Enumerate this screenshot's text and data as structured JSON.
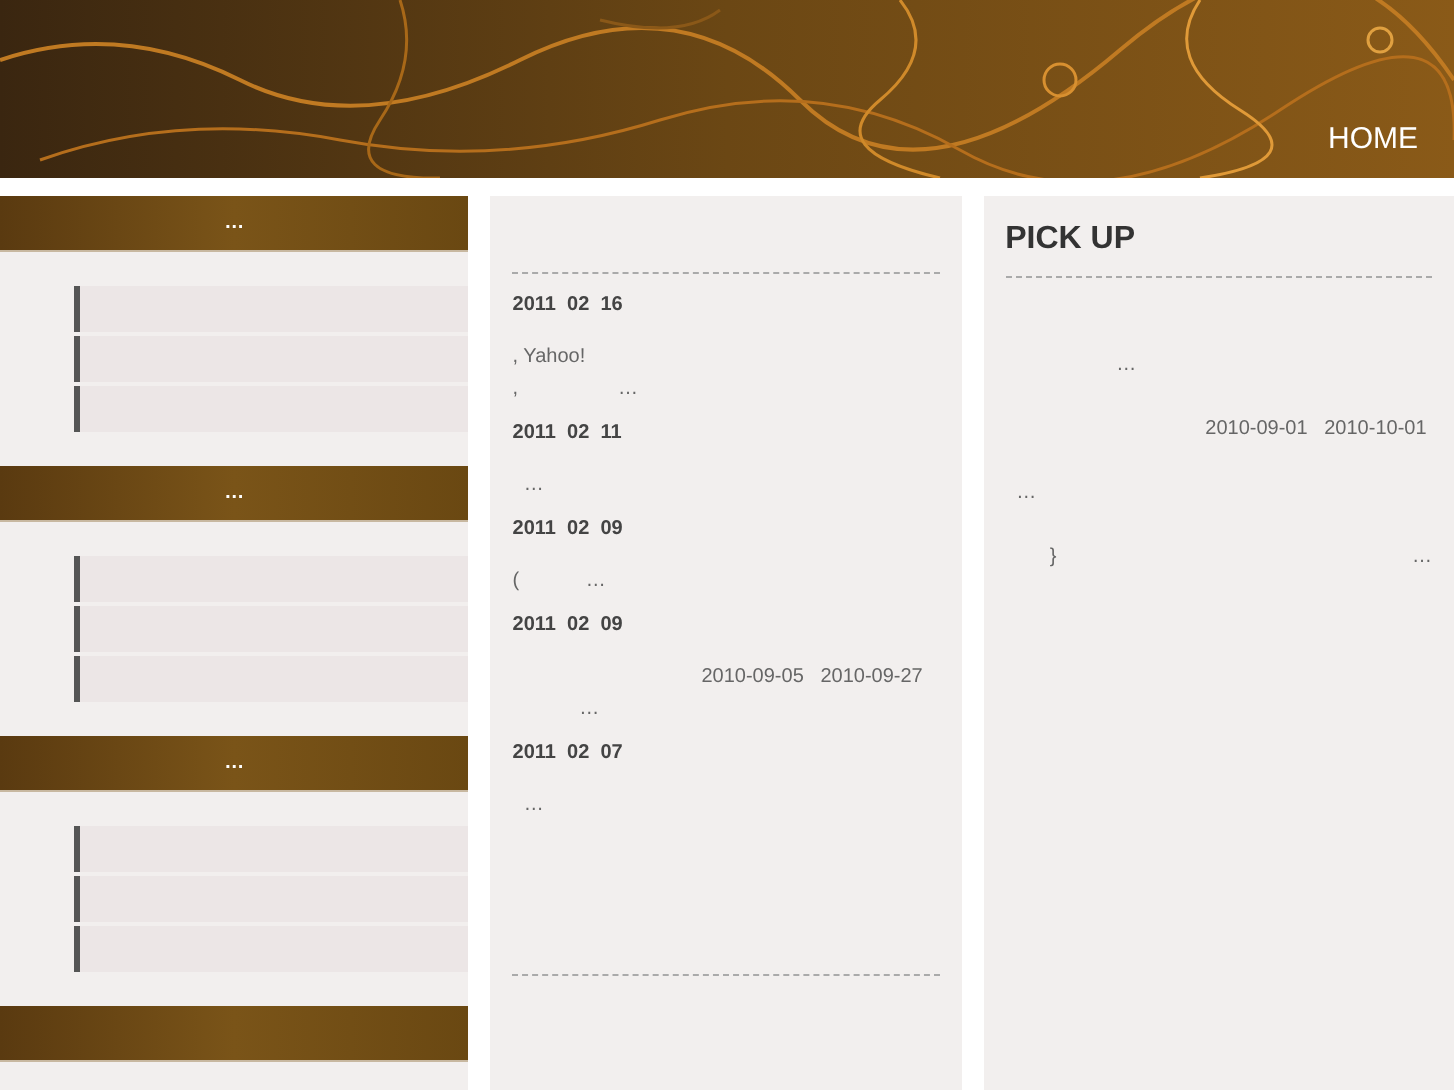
{
  "header": {
    "nav": [
      "HOME"
    ]
  },
  "sidebar": {
    "sections": [
      {
        "kind": "bar",
        "title": "…",
        "items": [
          {
            "kind": "link"
          },
          {
            "kind": "link"
          },
          {
            "kind": "link"
          }
        ]
      },
      {
        "kind": "bar",
        "title": "…",
        "items": [
          {
            "kind": "link"
          },
          {
            "kind": "link"
          },
          {
            "kind": "link"
          }
        ]
      },
      {
        "kind": "bar",
        "title": "…",
        "items": [
          {
            "kind": "link"
          },
          {
            "kind": "link"
          },
          {
            "kind": "link"
          }
        ]
      },
      {
        "kind": "bar"
      }
    ]
  },
  "posts": [
    {
      "date": "2011  02  16",
      "lines": [
        ", Yahoo!",
        ",                  …"
      ]
    },
    {
      "date": "2011  02  11",
      "lines": [
        "  …"
      ]
    },
    {
      "date": "2011  02  09",
      "lines": [
        "(            …"
      ]
    },
    {
      "date": "2011  02  09",
      "lines": [
        "                                  2010-09-05   2010-09-27",
        "            …"
      ]
    },
    {
      "date": "2011  02  07",
      "lines": [
        "  …"
      ]
    }
  ],
  "pickup": {
    "title": "PICK UP",
    "lines": [
      "                    …",
      "                                    2010-09-01   2010-10-01",
      "  …",
      "        }                                                                …"
    ]
  }
}
